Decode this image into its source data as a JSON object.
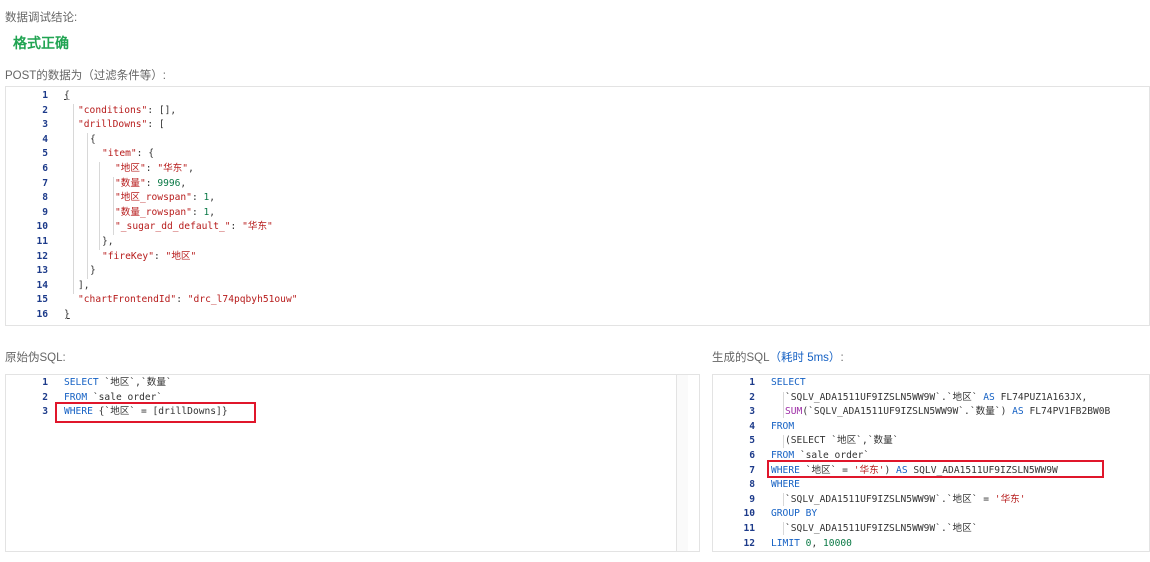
{
  "debug_conclusion_label": "数据调试结论:",
  "format_status": "格式正确",
  "post_data_label": "POST的数据为（过滤条件等）:",
  "post_json": {
    "line_numbers": [
      "1",
      "2",
      "3",
      "4",
      "5",
      "6",
      "7",
      "8",
      "9",
      "10",
      "11",
      "12",
      "13",
      "14",
      "15",
      "16"
    ],
    "l1": "{",
    "l2_key": "\"conditions\"",
    "l2_rest": ": [],",
    "l3_key": "\"drillDowns\"",
    "l3_rest": ": [",
    "l4": "{",
    "l5_key": "\"item\"",
    "l5_rest": ": {",
    "l6_key": "\"地区\"",
    "l6_colon": ": ",
    "l6_val": "\"华东\"",
    "l6_end": ",",
    "l7_key": "\"数量\"",
    "l7_colon": ": ",
    "l7_val": "9996",
    "l7_end": ",",
    "l8_key": "\"地区_rowspan\"",
    "l8_colon": ": ",
    "l8_val": "1",
    "l8_end": ",",
    "l9_key": "\"数量_rowspan\"",
    "l9_colon": ": ",
    "l9_val": "1",
    "l9_end": ",",
    "l10_key": "\"_sugar_dd_default_\"",
    "l10_colon": ": ",
    "l10_val": "\"华东\"",
    "l11": "},",
    "l12_key": "\"fireKey\"",
    "l12_colon": ": ",
    "l12_val": "\"地区\"",
    "l13": "}",
    "l14": "],",
    "l15_key": "\"chartFrontendId\"",
    "l15_colon": ": ",
    "l15_val": "\"drc_l74pqbyh51ouw\"",
    "l16": "}"
  },
  "raw_sql_label": "原始伪SQL:",
  "raw_sql": {
    "line_numbers": [
      "1",
      "2",
      "3"
    ],
    "l1_kw": "SELECT",
    "l1_rest": " `地区`,`数量`",
    "l2_kw": "FROM",
    "l2_rest": " `sale_order`",
    "l3_kw": "WHERE",
    "l3_rest": " {`地区` = [drillDowns]}"
  },
  "gen_sql_label": "生成的SQL",
  "gen_sql_time": "（耗时 5ms）",
  "gen_sql_colon": ":",
  "gen_sql": {
    "line_numbers": [
      "1",
      "2",
      "3",
      "4",
      "5",
      "6",
      "7",
      "8",
      "9",
      "10",
      "11",
      "12"
    ],
    "l1": "SELECT",
    "l2_a": "`SQLV_ADA1511UF9IZSLN5WW9W`.`地区`",
    "l2_as": " AS ",
    "l2_b": "FL74PUZ1A163JX,",
    "l3_fn": "SUM",
    "l3_a": "(`SQLV_ADA1511UF9IZSLN5WW9W`.`数量`)",
    "l3_as": " AS ",
    "l3_b": "FL74PV1FB2BW0B",
    "l4": "FROM",
    "l5": "(SELECT `地区`,`数量`",
    "l6_kw": "FROM",
    "l6_rest": " `sale_order`",
    "l7_kw": "WHERE",
    "l7_a": " `地区` = ",
    "l7_str": "'华东'",
    "l7_b": ") ",
    "l7_as": "AS",
    "l7_c": " SQLV_ADA1511UF9IZSLN5WW9W",
    "l8": "WHERE",
    "l9_a": "`SQLV_ADA1511UF9IZSLN5WW9W`.`地区` = ",
    "l9_str": "'华东'",
    "l10": "GROUP BY",
    "l11": "`SQLV_ADA1511UF9IZSLN5WW9W`.`地区`",
    "l12_kw": "LIMIT",
    "l12_a": " 0",
    "l12_b": ", ",
    "l12_c": "10000"
  },
  "colors": {
    "success": "#21a452",
    "keyword": "#1561c4",
    "string": "#b71c1c",
    "number": "#097845",
    "highlight_box": "#e0162b"
  }
}
